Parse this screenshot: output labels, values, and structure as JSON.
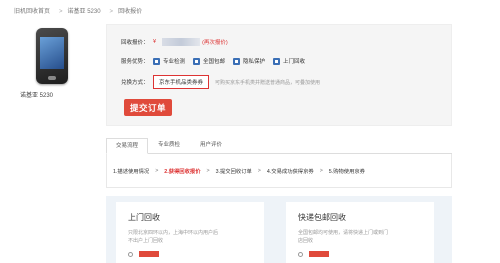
{
  "breadcrumb": [
    "旧机回收首页",
    "诺基亚 5230",
    "回收报价"
  ],
  "product": {
    "name": "诺基亚 5230"
  },
  "quote": {
    "label": "回收报价：",
    "suffix": "(再次报价)"
  },
  "services": {
    "label": "服务优势：",
    "items": [
      {
        "icon": "shield-icon",
        "label": "专业检测"
      },
      {
        "icon": "truck-icon",
        "label": "全国包邮"
      },
      {
        "icon": "lock-icon",
        "label": "隐私保护"
      },
      {
        "icon": "home-icon",
        "label": "上门回收"
      }
    ]
  },
  "method": {
    "label": "兑换方式：",
    "selected": "京东手机品类券券",
    "hint": "可购买京东手机类并赠送普通商品，可叠加使用"
  },
  "submit_label": "提交订单",
  "tabs": [
    "交易流程",
    "专业质检",
    "用户评价"
  ],
  "steps": [
    {
      "label": "1.描述使用情况",
      "current": false
    },
    {
      "label": "2.获得回收报价",
      "current": true
    },
    {
      "label": "3.提交回收订单",
      "current": false
    },
    {
      "label": "4.交易成功获得京券",
      "current": false
    },
    {
      "label": "5.购物使用京券",
      "current": false
    }
  ],
  "cards": [
    {
      "title": "上门回收",
      "desc": "只限北京四环以内，上海中环以内用户后不出户上门回收"
    },
    {
      "title": "快递包邮回收",
      "desc": "全国包邮均可使用，请将快递上门或到门店回收"
    }
  ],
  "colors": {
    "accent": "#e04a3b",
    "link": "#d33",
    "icon": "#3b6fb6"
  }
}
